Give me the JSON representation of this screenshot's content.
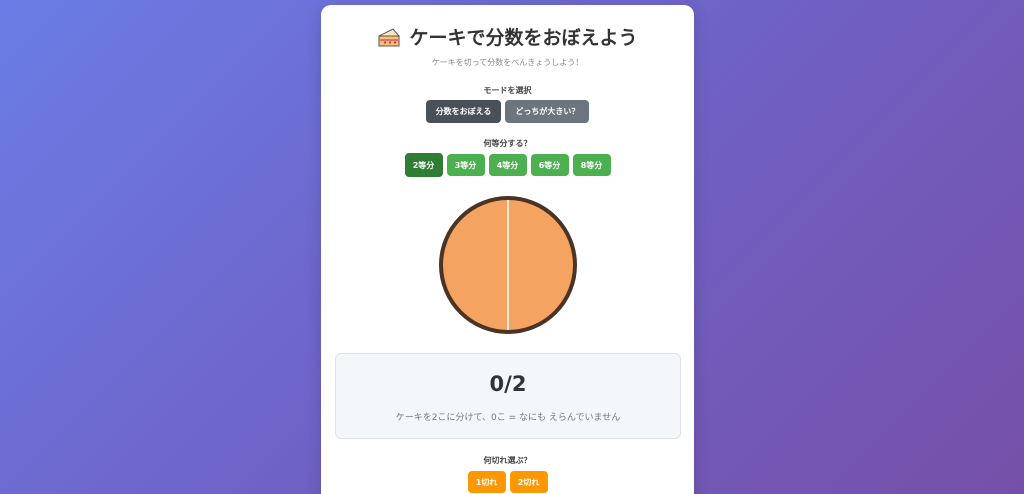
{
  "header": {
    "title": "ケーキで分数をおぼえよう",
    "subtitle": "ケーキを切って分数をべんきょうしよう！",
    "icon": "cake-icon"
  },
  "mode": {
    "label": "モードを選択",
    "buttons": [
      "分数をおぼえる",
      "どっちが大きい？"
    ],
    "selected": "分数をおぼえる"
  },
  "divisions": {
    "label": "何等分する？",
    "buttons": [
      "2等分",
      "3等分",
      "4等分",
      "6等分",
      "8等分"
    ],
    "selected": "2等分"
  },
  "cake": {
    "slices": 2,
    "selected": 0,
    "fill_color": "#f4a460",
    "border_color": "#4a3426"
  },
  "result": {
    "fraction": "0/2",
    "description": "ケーキを2こに分けて、0こ = なにも えらんでいません"
  },
  "pick": {
    "label": "何切れ選ぶ？",
    "buttons": [
      "1切れ",
      "2切れ"
    ]
  },
  "colors": {
    "accent_green": "#4caf50",
    "active_green": "#2e7d32",
    "pick_orange": "#ff9800",
    "mode_dark": "#495057",
    "mode_gray": "#6c757d"
  }
}
